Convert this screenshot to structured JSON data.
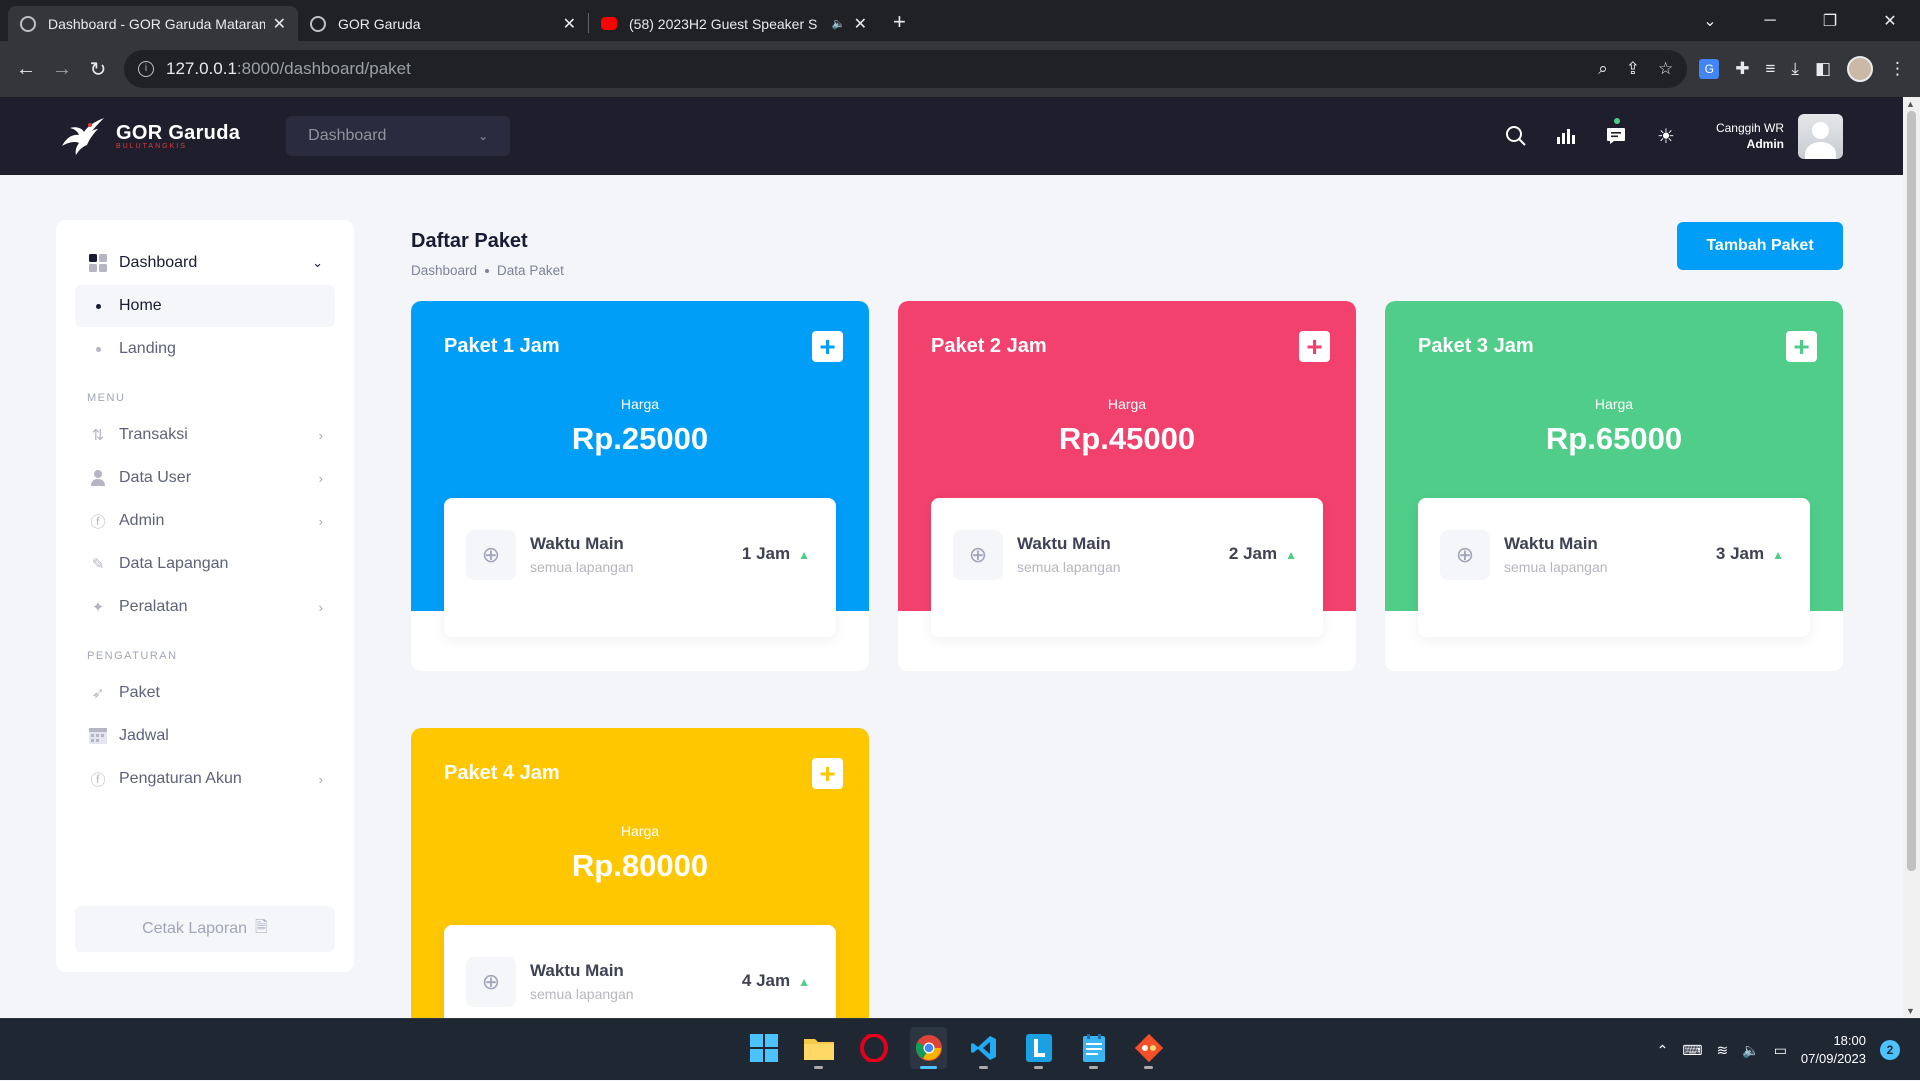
{
  "browser": {
    "tabs": [
      {
        "title": "Dashboard - GOR Garuda Mataram",
        "icon": "globe-icon",
        "active": true
      },
      {
        "title": "GOR Garuda",
        "icon": "globe-icon",
        "active": false
      },
      {
        "title": "(58) 2023H2 Guest Speaker S",
        "icon": "youtube-icon",
        "active": false
      }
    ],
    "url_host": "127.0.0.1",
    "url_path": ":8000/dashboard/paket"
  },
  "topnav": {
    "brand": "GOR Garuda",
    "brand_sub": "BULUTANGKIS",
    "selector": "Dashboard",
    "user_name": "Canggih WR",
    "user_role": "Admin"
  },
  "sidebar": {
    "dashboard": "Dashboard",
    "sub": [
      "Home",
      "Landing"
    ],
    "section_menu": "MENU",
    "menu": [
      {
        "label": "Transaksi",
        "icon": "transaction-icon",
        "arrow": true
      },
      {
        "label": "Data User",
        "icon": "user-icon",
        "arrow": true
      },
      {
        "label": "Admin",
        "icon": "fingerprint-icon",
        "arrow": true
      },
      {
        "label": "Data Lapangan",
        "icon": "brush-icon",
        "arrow": false
      },
      {
        "label": "Peralatan",
        "icon": "tools-icon",
        "arrow": true
      }
    ],
    "section_settings": "PENGATURAN",
    "settings": [
      {
        "label": "Paket",
        "icon": "rocket-icon",
        "arrow": false
      },
      {
        "label": "Jadwal",
        "icon": "calendar-icon",
        "arrow": false
      },
      {
        "label": "Pengaturan Akun",
        "icon": "fingerprint-icon",
        "arrow": true
      }
    ],
    "print_label": "Cetak Laporan"
  },
  "page": {
    "title": "Daftar Paket",
    "breadcrumb": [
      "Dashboard",
      "Data Paket"
    ],
    "add_button": "Tambah Paket"
  },
  "packages": [
    {
      "name": "Paket 1 Jam",
      "price_label": "Harga",
      "price": "Rp.25000",
      "item": "Waktu Main",
      "scope": "semua lapangan",
      "duration": "1 Jam",
      "color": "#009ef7"
    },
    {
      "name": "Paket 2 Jam",
      "price_label": "Harga",
      "price": "Rp.45000",
      "item": "Waktu Main",
      "scope": "semua lapangan",
      "duration": "2 Jam",
      "color": "#f1416c"
    },
    {
      "name": "Paket 3 Jam",
      "price_label": "Harga",
      "price": "Rp.65000",
      "item": "Waktu Main",
      "scope": "semua lapangan",
      "duration": "3 Jam",
      "color": "#50cd89"
    },
    {
      "name": "Paket 4 Jam",
      "price_label": "Harga",
      "price": "Rp.80000",
      "item": "Waktu Main",
      "scope": "semua lapangan",
      "duration": "4 Jam",
      "color": "#ffc700"
    }
  ],
  "taskbar": {
    "time": "18:00",
    "date": "07/09/2023",
    "notifications": "2"
  }
}
